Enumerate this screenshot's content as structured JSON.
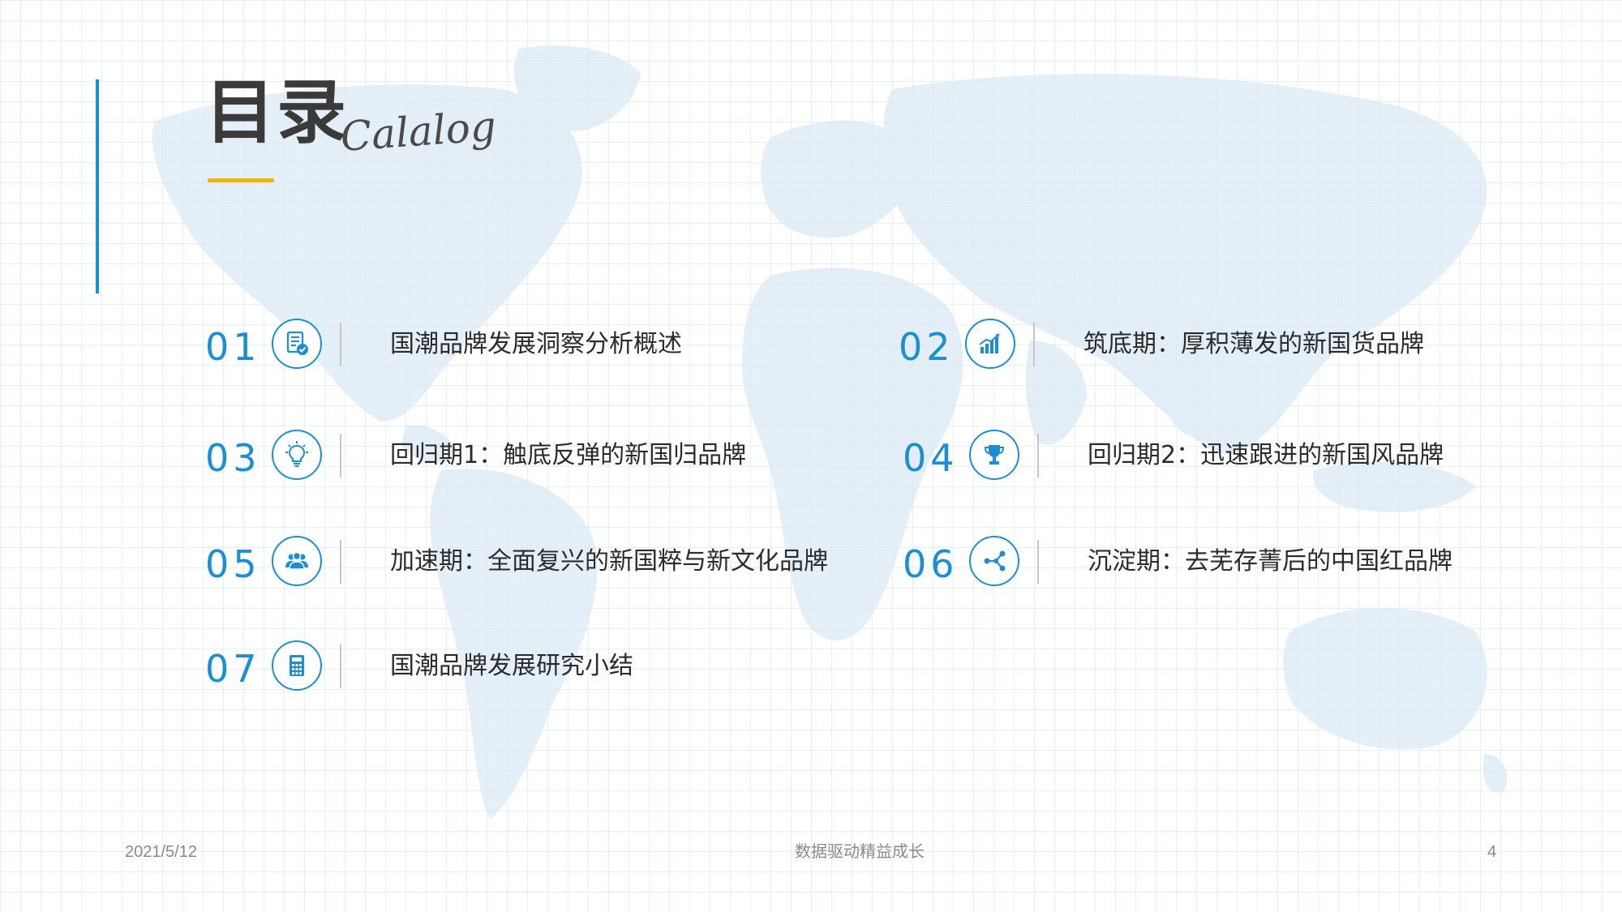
{
  "header": {
    "title": "目录",
    "subtitle": "Calalog"
  },
  "items": [
    {
      "number": "01",
      "label": "国潮品牌发展洞察分析概述",
      "icon": "report-check-icon"
    },
    {
      "number": "02",
      "label": "筑底期：厚积薄发的新国货品牌",
      "icon": "growth-chart-icon"
    },
    {
      "number": "03",
      "label": "回归期1：触底反弹的新国归品牌",
      "icon": "lightbulb-icon"
    },
    {
      "number": "04",
      "label": "回归期2：迅速跟进的新国风品牌",
      "icon": "trophy-icon"
    },
    {
      "number": "05",
      "label": "加速期：全面复兴的新国粹与新文化品牌",
      "icon": "team-icon"
    },
    {
      "number": "06",
      "label": "沉淀期：去芜存菁后的中国红品牌",
      "icon": "share-nodes-icon"
    },
    {
      "number": "07",
      "label": "国潮品牌发展研究小结",
      "icon": "calculator-icon"
    }
  ],
  "footer": {
    "date": "2021/5/12",
    "center": "数据驱动精益成长",
    "page": "4"
  },
  "colors": {
    "accent": "#1a8fd6",
    "underline": "#f2b600",
    "text": "#2b2b2b",
    "map": "#dbe9f5"
  }
}
